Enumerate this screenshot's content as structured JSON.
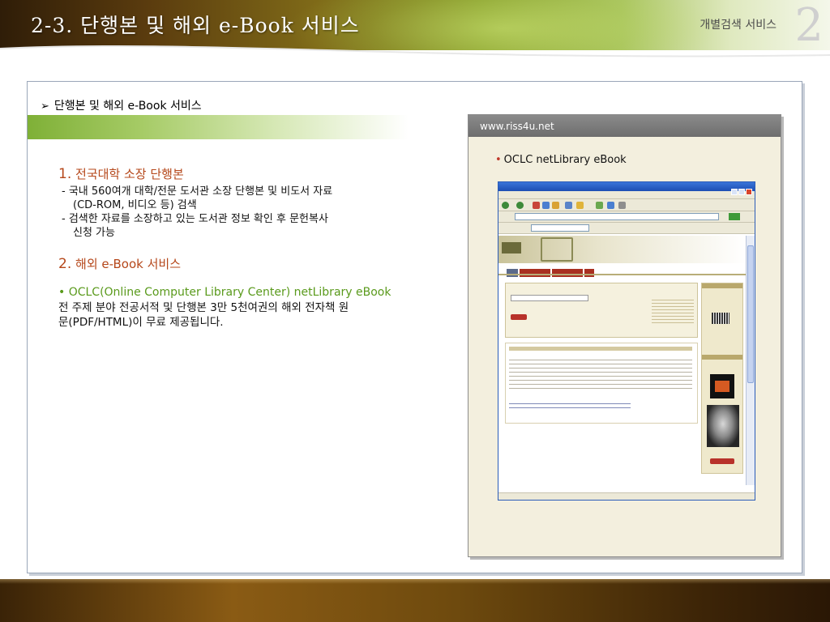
{
  "header": {
    "title": "2-3. 단행본 및 해외 e-Book 서비스",
    "subtitle": "개별검색 서비스",
    "number": "2"
  },
  "content": {
    "heading": "단행본 및 해외 e-Book 서비스",
    "sections": [
      {
        "number": "1.",
        "title": "전국대학 소장 단행본",
        "lines": [
          "- 국내 560여개 대학/전문 도서관 소장 단행본 및 비도서 자료",
          "(CD-ROM, 비디오 등) 검색",
          "- 검색한 자료를 소장하고 있는 도서관 정보 확인 후 문헌복사",
          "신청 가능"
        ]
      },
      {
        "number": "2.",
        "title": "해외 e-Book 서비스",
        "bullet": "• OCLC(Online Computer Library Center) netLibrary eBook",
        "desc_lines": [
          "전 주제 분야 전공서적 및 단행본 3만 5천여권의 해외 전자책 원",
          "문(PDF/HTML)이 무료 제공됩니다."
        ]
      }
    ]
  },
  "panel": {
    "header": "www.riss4u.net",
    "bullet": "OCLC netLibrary eBook"
  },
  "colors": {
    "section_title": "#b5471a",
    "oclc_green": "#5a9a1c",
    "panel_bg": "#f3efde",
    "panel_header": "#7a7a7a"
  }
}
